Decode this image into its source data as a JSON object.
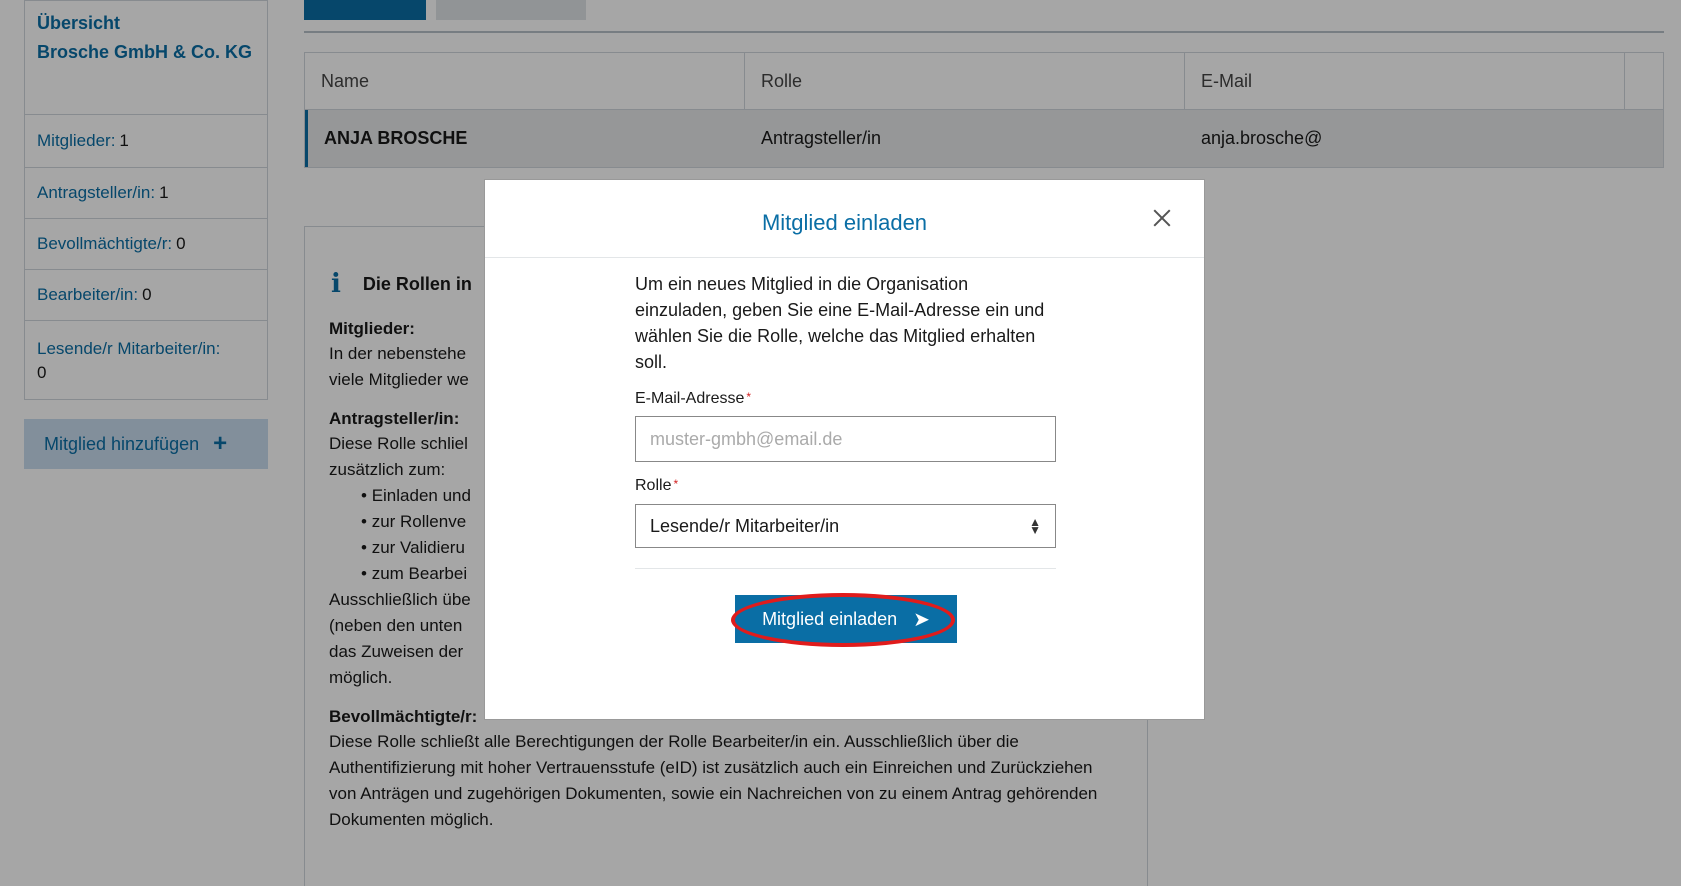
{
  "sidebar": {
    "title_line1": "Übersicht",
    "title_line2": "Brosche GmbH & Co. KG",
    "items": [
      {
        "label": "Mitglieder:",
        "value": "1"
      },
      {
        "label": "Antragsteller/in:",
        "value": "1"
      },
      {
        "label": "Bevollmächtigte/r:",
        "value": "0"
      },
      {
        "label": "Bearbeiter/in:",
        "value": "0"
      },
      {
        "label": "Lesende/r Mitarbeiter/in:",
        "value": "0"
      }
    ],
    "add_button": "Mitglied hinzufügen",
    "add_icon": "+"
  },
  "table": {
    "headers": [
      "Name",
      "Rolle",
      "E-Mail"
    ],
    "rows": [
      {
        "name": "ANJA BROSCHE",
        "role": "Antragsteller/in",
        "email": "anja.brosche@"
      }
    ]
  },
  "info": {
    "heading": "Die Rollen in",
    "sections": [
      {
        "title": "Mitglieder:",
        "lines": [
          "In der nebenstehe",
          "viele Mitglieder we"
        ]
      },
      {
        "title": "Antragsteller/in:",
        "lines": [
          "Diese Rolle schliel",
          "zusätzlich zum:"
        ],
        "bullets": [
          "Einladen und",
          "zur Rollenve",
          "zur Validieru",
          "zum Bearbei"
        ],
        "after": [
          "Ausschließlich übe",
          "(neben den unten",
          "das Zuweisen der",
          "möglich."
        ]
      },
      {
        "title": "Bevollmächtigte/r:",
        "text": "Diese Rolle schließt alle Berechtigungen der Rolle Bearbeiter/in ein. Ausschließlich über die Authentifizierung mit hoher Vertrauensstufe (eID) ist zusätzlich auch ein Einreichen und Zurückziehen von Anträgen und zugehörigen Dokumenten, sowie ein Nachreichen von zu einem Antrag gehörenden Dokumenten möglich."
      }
    ]
  },
  "modal": {
    "title": "Mitglied einladen",
    "intro": "Um ein neues Mitglied in die Organisation einzuladen, geben Sie eine E-Mail-Adresse ein und wählen Sie die Rolle, welche das Mitglied erhalten soll.",
    "email_label": "E-Mail-Adresse",
    "email_placeholder": "muster-gmbh@email.de",
    "role_label": "Rolle",
    "role_selected": "Lesende/r Mitarbeiter/in",
    "required_mark": "*",
    "submit_label": "Mitglied einladen"
  }
}
